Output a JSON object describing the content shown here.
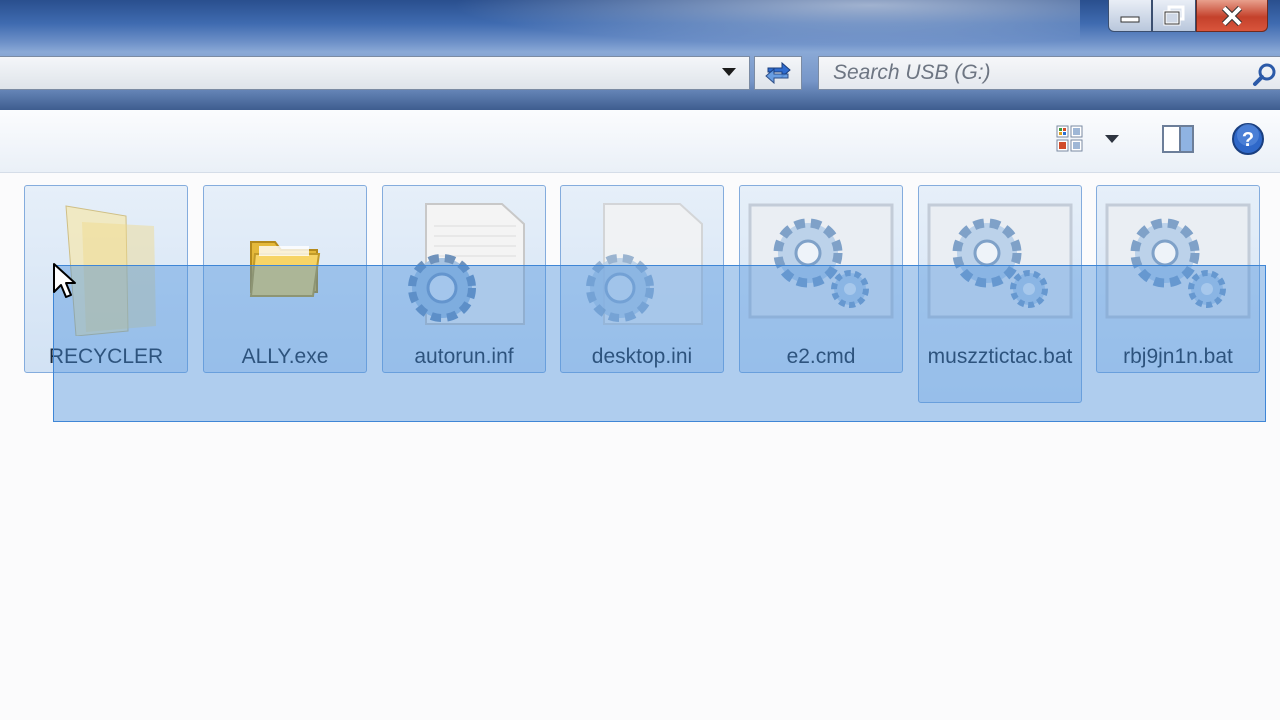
{
  "window": {
    "buttons": {
      "minimize": "minimize",
      "restore": "restore",
      "close": "close"
    }
  },
  "address": {
    "path": ""
  },
  "search": {
    "placeholder": "Search USB (G:)"
  },
  "toolbar": {
    "icons": [
      "change-view-icon",
      "view-dropdown-icon",
      "preview-pane-icon",
      "help-icon"
    ]
  },
  "files": [
    {
      "name": "RECYCLER",
      "type": "folder-open"
    },
    {
      "name": "ALLY.exe",
      "type": "folder"
    },
    {
      "name": "autorun.inf",
      "type": "settings-file"
    },
    {
      "name": "desktop.ini",
      "type": "settings-file"
    },
    {
      "name": "e2.cmd",
      "type": "batch-file"
    },
    {
      "name": "muszztictac.bat",
      "type": "batch-file"
    },
    {
      "name": "rbj9jn1n.bat",
      "type": "batch-file"
    }
  ],
  "colors": {
    "selection": "#468cdc",
    "titlebar": "#3f6bb0",
    "close_button": "#c4412b"
  }
}
